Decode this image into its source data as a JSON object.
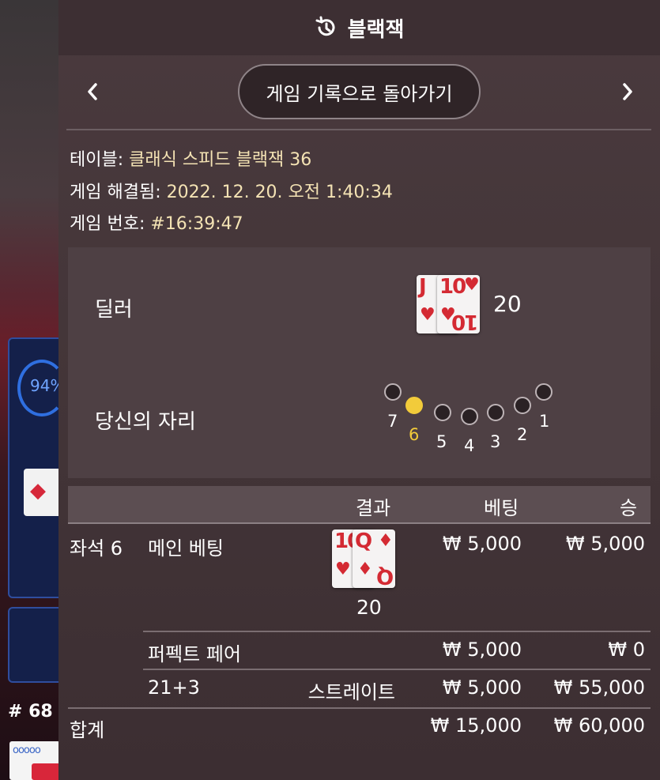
{
  "header": {
    "title": "블랙잭",
    "icon": "history-icon"
  },
  "nav": {
    "back_label": "게임 기록으로 돌아가기",
    "prev_icon": "chevron-left-icon",
    "next_icon": "chevron-right-icon"
  },
  "meta": {
    "table_label": "테이블: ",
    "table_value": "클래식 스피드 블랙잭 36",
    "resolved_label": "게임 해결됨: ",
    "resolved_value": "2022. 12. 20. 오전 1:40:34",
    "game_no_label": "게임 번호: ",
    "game_no_value": "#16:39:47"
  },
  "dealer": {
    "label": "딜러",
    "cards": [
      {
        "rank": "J",
        "suit": "♥",
        "flip": ""
      },
      {
        "rank": "10",
        "suit": "♥",
        "flip": "10"
      }
    ],
    "total": "20"
  },
  "seat": {
    "label": "당신의 자리",
    "seats": [
      "7",
      "6",
      "5",
      "4",
      "3",
      "2",
      "1"
    ],
    "active_seat": "6"
  },
  "table": {
    "headers": {
      "result": "결과",
      "bet": "베팅",
      "win": "승"
    },
    "seat_label": "좌석 6",
    "main_bet": {
      "label": "메인 베팅",
      "cards": [
        {
          "rank": "10",
          "suit": "♥",
          "flip": ""
        },
        {
          "rank": "Q",
          "suit": "♦",
          "flip": "Q"
        }
      ],
      "total": "20",
      "bet": "₩ 5,000",
      "win": "₩ 5,000"
    },
    "perfect_pair": {
      "label": "퍼펙트 페어",
      "result": "",
      "bet": "₩ 5,000",
      "win": "₩ 0"
    },
    "side_21_3": {
      "label": "21+3",
      "result": "스트레이트",
      "bet": "₩ 5,000",
      "win": "₩ 55,000"
    },
    "total": {
      "label": "합계",
      "bet": "₩ 15,000",
      "win": "₩ 60,000"
    }
  },
  "background": {
    "progress": "94%",
    "round": "# 68"
  },
  "colors": {
    "accent_gold": "#f2cb3a",
    "meta_value": "#f4e3b4",
    "card_red": "#d42a33"
  }
}
